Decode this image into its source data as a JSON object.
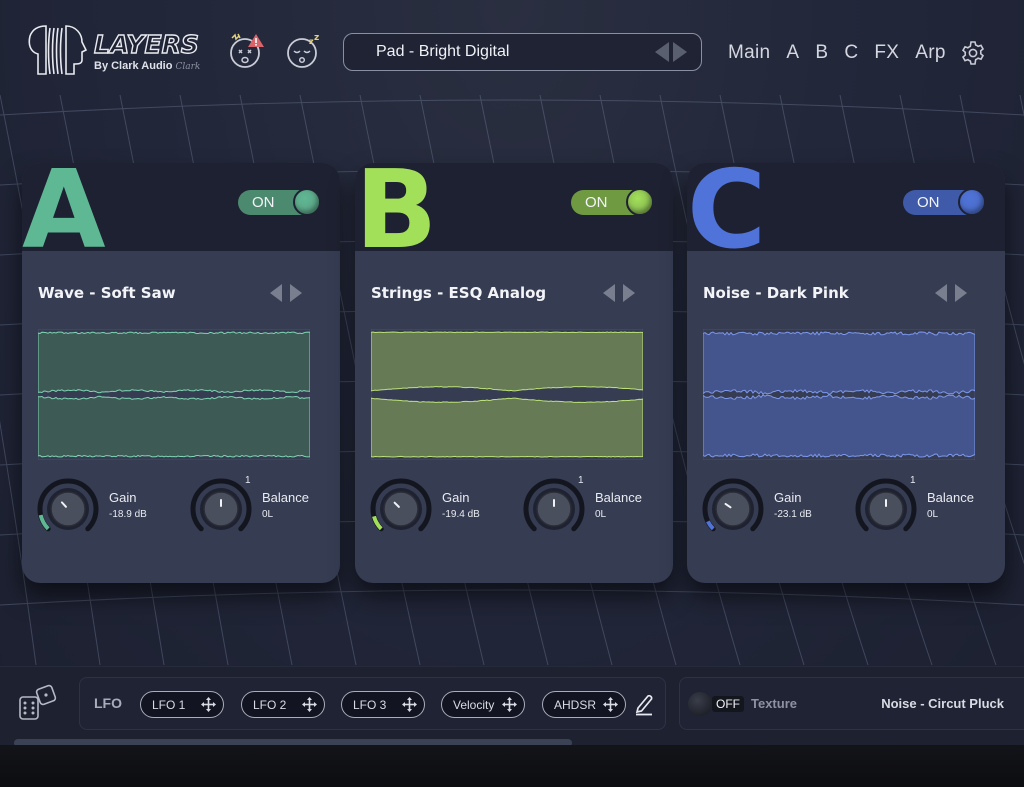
{
  "app": {
    "logo_title": "LAYERS",
    "logo_subtitle": "By Clark Audio",
    "logo_signature": "Clark",
    "icons": {
      "panic": "panic-face-warning-icon",
      "sleep": "sleeping-face-icon",
      "settings": "gear-icon"
    }
  },
  "preset": {
    "name": "Pad - Bright Digital",
    "prev_icon": "triangle-left-icon",
    "next_icon": "triangle-right-icon"
  },
  "nav": {
    "items": [
      {
        "label": "Main"
      },
      {
        "label": "A"
      },
      {
        "label": "B"
      },
      {
        "label": "C"
      },
      {
        "label": "FX"
      },
      {
        "label": "Arp"
      }
    ]
  },
  "layers": [
    {
      "letter": "A",
      "color": "#5fb894",
      "toggle_state": "ON",
      "toggle_track": "#4c8a70",
      "toggle_knob": "#5a9a80",
      "name": "Wave - Soft Saw",
      "wave_fill": "#3e5a55",
      "wave_line": "#7fd4b2",
      "gain_label": "Gain",
      "gain_value": "-18.9 dB",
      "gain_fraction": 0.12,
      "balance_label": "Balance",
      "balance_value": "0L",
      "balance_marker": "1"
    },
    {
      "letter": "B",
      "color": "#a3e05a",
      "toggle_state": "ON",
      "toggle_track": "#6f9a42",
      "toggle_knob": "#7aa64c",
      "name": "Strings - ESQ Analog",
      "wave_fill": "#667a55",
      "wave_line": "#bde27a",
      "gain_label": "Gain",
      "gain_value": "-19.4 dB",
      "gain_fraction": 0.11,
      "balance_label": "Balance",
      "balance_value": "0L",
      "balance_marker": "1"
    },
    {
      "letter": "C",
      "color": "#4f73d8",
      "toggle_state": "ON",
      "toggle_track": "#3e5aa8",
      "toggle_knob": "#4868c0",
      "name": "Noise - Dark Pink",
      "wave_fill": "#44558e",
      "wave_line": "#7d98ec",
      "gain_label": "Gain",
      "gain_value": "-23.1 dB",
      "gain_fraction": 0.07,
      "balance_label": "Balance",
      "balance_value": "0L",
      "balance_marker": "1"
    }
  ],
  "modulation": {
    "title": "LFO",
    "sources": [
      {
        "label": "LFO 1"
      },
      {
        "label": "LFO 2"
      },
      {
        "label": "LFO 3"
      },
      {
        "label": "Velocity"
      },
      {
        "label": "AHDSR"
      }
    ],
    "edit_icon": "pencil-icon",
    "randomize_icon": "dice-icon"
  },
  "texture": {
    "state": "OFF",
    "label": "Texture",
    "preset": "Noise - Circut Pluck"
  }
}
